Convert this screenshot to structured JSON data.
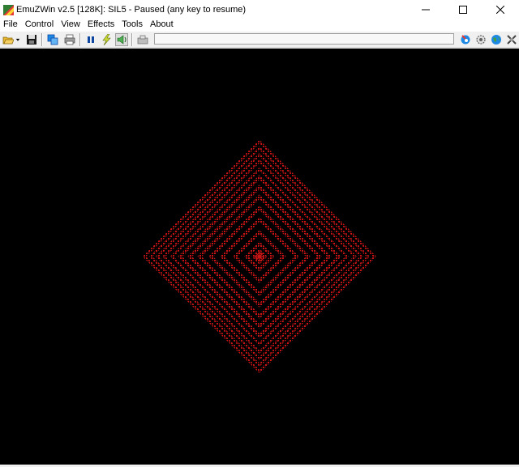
{
  "window": {
    "title": "EmuZWin v2.5 [128K]: SIL5 - Paused (any key to resume)",
    "controls": [
      "minimize-icon",
      "maximize-icon",
      "close-icon"
    ]
  },
  "menu": {
    "items": [
      {
        "label": "File"
      },
      {
        "label": "Control"
      },
      {
        "label": "View"
      },
      {
        "label": "Effects"
      },
      {
        "label": "Tools"
      },
      {
        "label": "About"
      }
    ]
  },
  "toolbar": {
    "buttons": [
      "open-folder-icon",
      "dropdown-arrow-icon",
      "save-disk-icon",
      "snapshot-icon",
      "printer-icon",
      "pause-icon",
      "turbo-lightning-icon",
      "sound-speaker-icon",
      "tape-icon",
      "help-icon",
      "settings-icon",
      "web-globe-icon",
      "exit-icon"
    ],
    "status_text": ""
  },
  "screen": {
    "background": "#000000",
    "pattern_color": "#c81414",
    "pattern": "concentric-diamonds"
  }
}
